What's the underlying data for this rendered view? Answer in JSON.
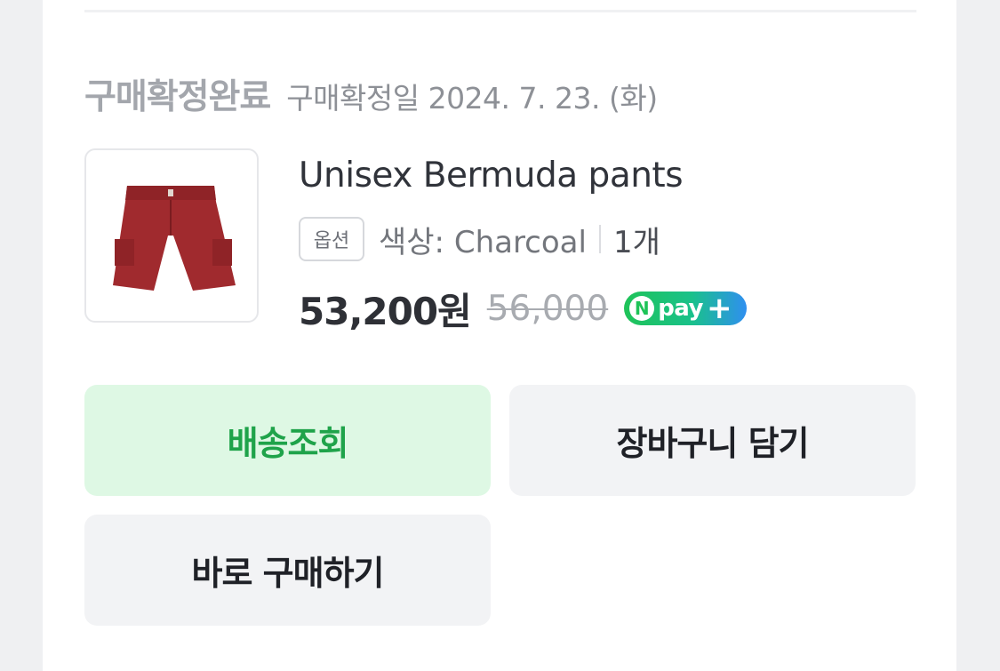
{
  "order": {
    "status": "구매확정완료",
    "confirm_date": "구매확정일 2024. 7. 23. (화)"
  },
  "product": {
    "name": "Unisex Bermuda pants",
    "option_chip": "옵션",
    "option_value": "색상: Charcoal",
    "quantity": "1개",
    "price": "53,200원",
    "original_price": "56,000",
    "image_desc_icon": "red-shorts-image",
    "image_color": "#a02a2e"
  },
  "npay": {
    "badge_letter": "N",
    "label": "pay",
    "plus": "+"
  },
  "actions": {
    "track_label": "배송조회",
    "cart_label": "장바구니 담기",
    "buy_label": "바로 구매하기"
  },
  "colors": {
    "track_bg": "#def8e4",
    "track_text": "#1fa34a",
    "neutral_bg": "#f2f3f5"
  }
}
